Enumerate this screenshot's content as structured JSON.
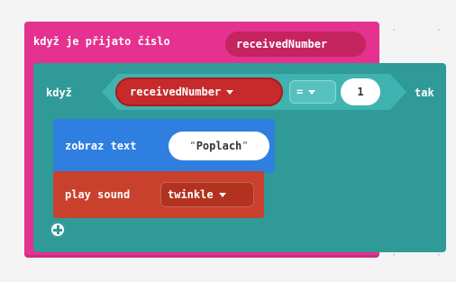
{
  "radio_event": {
    "label": "když je přijato číslo",
    "param": "receivedNumber",
    "color": "#e5318f"
  },
  "if_block": {
    "if_label": "když",
    "then_label": "tak",
    "color": "#2f9a98",
    "condition": {
      "variable": "receivedNumber",
      "operator": "=",
      "value": "1"
    }
  },
  "show_string": {
    "label": "zobraz text",
    "value": "Poplach",
    "color": "#2f7fe0"
  },
  "play_sound": {
    "label": "play sound",
    "sound": "twinkle",
    "color": "#c9402c"
  },
  "icons": {
    "dropdown": "chevron-down-icon",
    "add": "plus-circle-icon"
  }
}
